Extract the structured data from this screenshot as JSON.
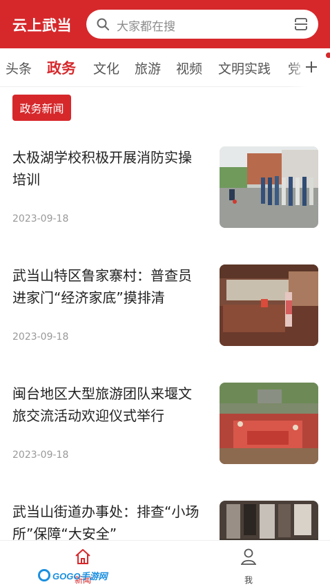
{
  "header": {
    "brand": "云上武当",
    "search_placeholder": "大家都在搜"
  },
  "tabs": [
    "头条",
    "政务",
    "文化",
    "旅游",
    "视频",
    "文明实践",
    "党"
  ],
  "active_tab": "政务",
  "section_tag": "政务新闻",
  "articles": [
    {
      "title": "太极湖学校积极开展消防实操培训",
      "date": "2023-09-18",
      "thumb": "fire-drill-photo"
    },
    {
      "title": "武当山特区鲁家寨村：普查员进家门“经济家底”摸排清",
      "date": "2023-09-18",
      "thumb": "census-visit-photo"
    },
    {
      "title": "闽台地区大型旅游团队来堰文旅交流活动欢迎仪式举行",
      "date": "2023-09-18",
      "thumb": "welcome-ceremony-photo"
    },
    {
      "title": "武当山街道办事处：排查“小场所”保障“大安全”",
      "date": "",
      "thumb": "shop-inspection-photo"
    }
  ],
  "bottom_nav": {
    "home_label": "新闻",
    "me_label": "我"
  },
  "watermark": "GOGO手游网",
  "colors": {
    "brand_red": "#d6282b"
  }
}
